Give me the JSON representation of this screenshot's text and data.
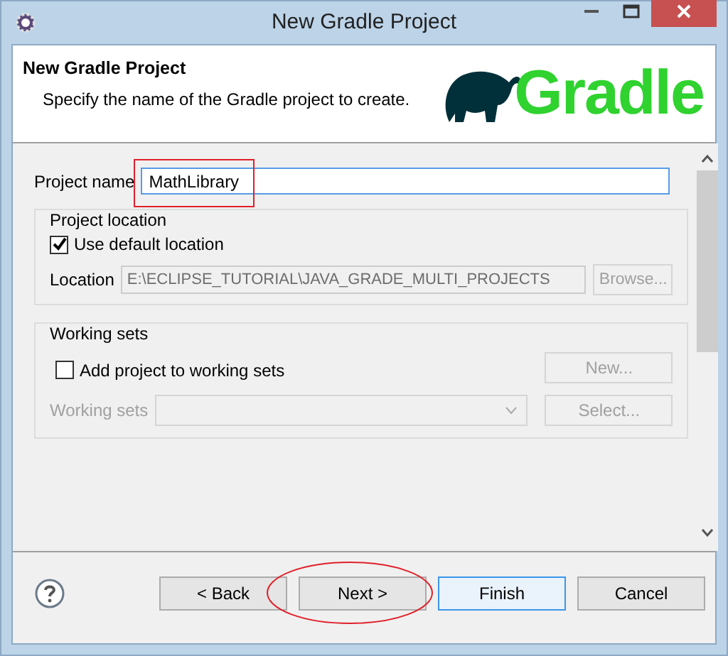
{
  "window": {
    "title": "New Gradle Project"
  },
  "header": {
    "title": "New Gradle Project",
    "description": "Specify the name of the Gradle project to create.",
    "logo_text": "Gradle"
  },
  "project_name": {
    "label": "Project name",
    "value": "MathLibrary"
  },
  "project_location": {
    "title": "Project location",
    "use_default": {
      "label": "Use default location",
      "checked": true
    },
    "location": {
      "label": "Location",
      "value": "E:\\ECLIPSE_TUTORIAL\\JAVA_GRADE_MULTI_PROJECTS",
      "disabled": true
    },
    "browse": {
      "label": "Browse...",
      "disabled": true
    }
  },
  "working_sets": {
    "title": "Working sets",
    "add": {
      "label": "Add project to working sets",
      "checked": false
    },
    "new_button": {
      "label": "New...",
      "disabled": true
    },
    "sets_label": {
      "label": "Working sets",
      "disabled": true
    },
    "select_button": {
      "label": "Select...",
      "disabled": true
    }
  },
  "buttons": [
    {
      "label": "< Back",
      "focused": false
    },
    {
      "label": "Next >",
      "focused": false
    },
    {
      "label": "Finish",
      "focused": true
    },
    {
      "label": "Cancel",
      "focused": false
    }
  ]
}
